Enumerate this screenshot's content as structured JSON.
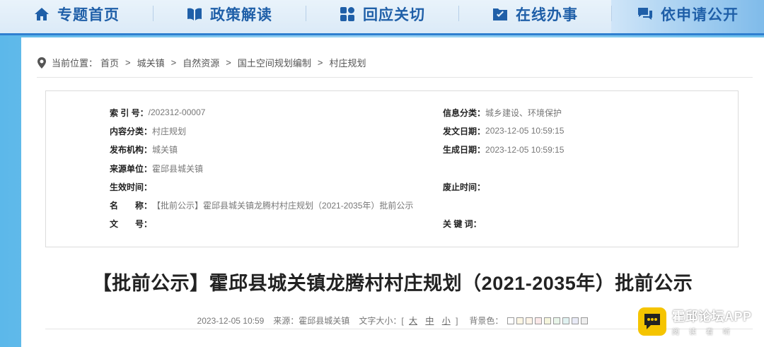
{
  "nav": {
    "items": [
      {
        "label": "专题首页",
        "icon": "home-icon"
      },
      {
        "label": "政策解读",
        "icon": "book-icon"
      },
      {
        "label": "回应关切",
        "icon": "grid-icon"
      },
      {
        "label": "在线办事",
        "icon": "check-folder-icon"
      },
      {
        "label": "依申请公开",
        "icon": "chat-icon"
      }
    ]
  },
  "breadcrumb": {
    "prefix": "当前位置：",
    "items": [
      "首页",
      "城关镇",
      "自然资源",
      "国土空间规划编制",
      "村庄规划"
    ],
    "separator": ">"
  },
  "meta": {
    "left": [
      {
        "k": "索 引 号：",
        "v": "/202312-00007"
      },
      {
        "k": "内容分类：",
        "v": "村庄规划"
      },
      {
        "k": "发布机构：",
        "v": "城关镇"
      },
      {
        "k": "来源单位：",
        "v": "霍邱县城关镇"
      },
      {
        "k": "生效时间：",
        "v": ""
      },
      {
        "k": "名　　称：",
        "v": "【批前公示】霍邱县城关镇龙腾村村庄规划（2021-2035年）批前公示"
      },
      {
        "k": "文　　号：",
        "v": ""
      }
    ],
    "right": [
      {
        "k": "信息分类：",
        "v": "城乡建设、环境保护"
      },
      {
        "k": "发文日期：",
        "v": "2023-12-05 10:59:15"
      },
      {
        "k": "生成日期：",
        "v": "2023-12-05 10:59:15"
      },
      {
        "k": "",
        "v": ""
      },
      {
        "k": "废止时间：",
        "v": ""
      },
      {
        "k": "",
        "v": ""
      },
      {
        "k": "关 键 词：",
        "v": ""
      }
    ]
  },
  "article": {
    "title": "【批前公示】霍邱县城关镇龙腾村村庄规划（2021-2035年）批前公示",
    "date": "2023-12-05 10:59",
    "source": "来源：霍邱县城关镇",
    "font_size_label": "文字大小：[",
    "font_sizes": [
      "大",
      "中",
      "小"
    ],
    "font_size_close": "]",
    "bg_label": "背景色：",
    "bg_colors": [
      "#ffffff",
      "#fdf6e3",
      "#fff4e6",
      "#fbe8e8",
      "#f5f5dc",
      "#e8f5e9",
      "#e0f2f1",
      "#e8eaf6",
      "#eeeeee"
    ]
  },
  "watermark": {
    "title": "霍邱论坛APP",
    "subtitle": "阅读看听"
  }
}
